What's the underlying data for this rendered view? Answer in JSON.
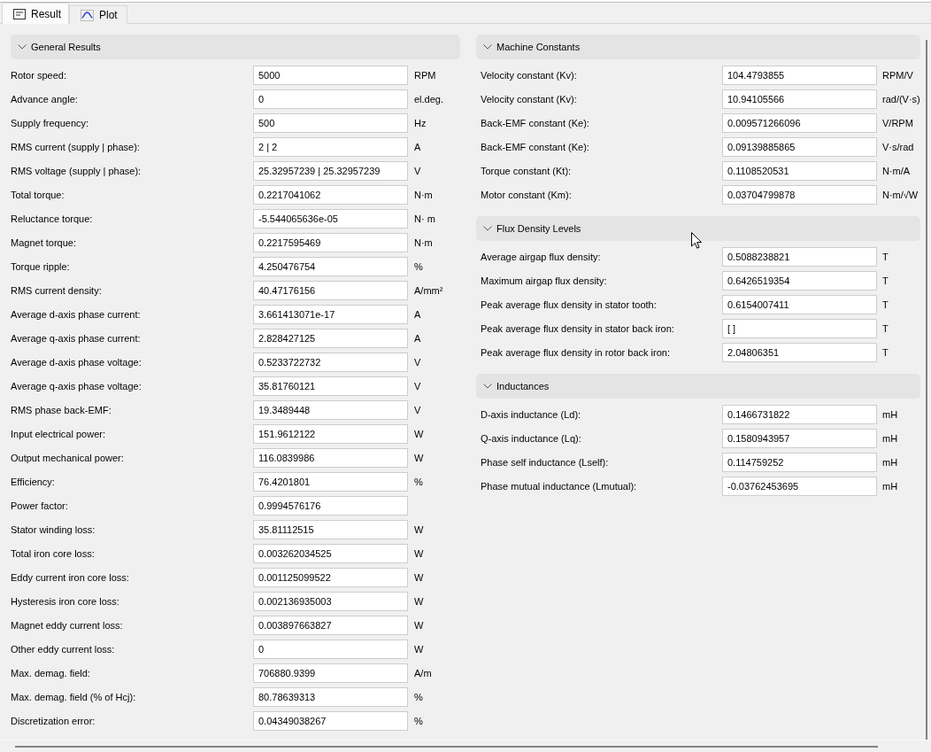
{
  "tabs": [
    {
      "label": "Result",
      "kind": "text",
      "selected": true
    },
    {
      "label": "Plot",
      "kind": "plot",
      "selected": false
    }
  ],
  "left_column": {
    "sections": [
      {
        "title": "General Results",
        "expanded": true,
        "rows": [
          {
            "label": "Rotor speed:",
            "value": "5000",
            "unit": "RPM"
          },
          {
            "label": "Advance angle:",
            "value": "0",
            "unit": "el.deg."
          },
          {
            "label": "Supply frequency:",
            "value": "500",
            "unit": "Hz"
          },
          {
            "label": "RMS current (supply | phase):",
            "value": "2 | 2",
            "unit": "A"
          },
          {
            "label": "RMS voltage (supply | phase):",
            "value": "25.32957239 | 25.32957239",
            "unit": "V"
          },
          {
            "label": "Total torque:",
            "value": "0.2217041062",
            "unit": "N·m"
          },
          {
            "label": "Reluctance torque:",
            "value": "-5.544065636e-05",
            "unit": "N· m"
          },
          {
            "label": "Magnet torque:",
            "value": "0.2217595469",
            "unit": "N·m"
          },
          {
            "label": "Torque ripple:",
            "value": "4.250476754",
            "unit": "%"
          },
          {
            "label": "RMS current density:",
            "value": "40.47176156",
            "unit": "A/mm²"
          },
          {
            "label": "Average d-axis phase current:",
            "value": "3.661413071e-17",
            "unit": "A"
          },
          {
            "label": "Average q-axis phase current:",
            "value": "2.828427125",
            "unit": "A"
          },
          {
            "label": "Average d-axis phase voltage:",
            "value": "0.5233722732",
            "unit": "V"
          },
          {
            "label": "Average q-axis phase voltage:",
            "value": "35.81760121",
            "unit": "V"
          },
          {
            "label": "RMS phase back-EMF:",
            "value": "19.3489448",
            "unit": "V"
          },
          {
            "label": "Input electrical power:",
            "value": "151.9612122",
            "unit": "W"
          },
          {
            "label": "Output mechanical power:",
            "value": "116.0839986",
            "unit": "W"
          },
          {
            "label": "Efficiency:",
            "value": "76.4201801",
            "unit": "%"
          },
          {
            "label": "Power factor:",
            "value": "0.9994576176"
          },
          {
            "label": "Stator winding loss:",
            "value": "35.81112515",
            "unit": "W"
          },
          {
            "label": "Total iron core loss:",
            "value": "0.003262034525",
            "unit": "W"
          },
          {
            "label": "Eddy current iron core loss:",
            "value": "0.001125099522",
            "unit": "W"
          },
          {
            "label": "Hysteresis iron core loss:",
            "value": "0.002136935003",
            "unit": "W"
          },
          {
            "label": "Magnet eddy current loss:",
            "value": "0.003897663827",
            "unit": "W"
          },
          {
            "label": "Other eddy current loss:",
            "value": "0",
            "unit": "W"
          },
          {
            "label": "Max. demag. field:",
            "value": "706880.9399",
            "unit": "A/m"
          },
          {
            "label": "Max. demag. field (% of Hcj):",
            "value": "80.78639313",
            "unit": "%"
          },
          {
            "label": "Discretization error:",
            "value": "0.04349038267",
            "unit": "%"
          }
        ]
      }
    ]
  },
  "right_column": {
    "sections": [
      {
        "title": "Machine Constants",
        "expanded": true,
        "rows": [
          {
            "label": "Velocity constant (Kv):",
            "value": "104.4793855",
            "unit": "RPM/V"
          },
          {
            "label": "Velocity constant (Kv):",
            "value": "10.94105566",
            "unit": "rad/(V·s)"
          },
          {
            "label": "Back-EMF constant (Ke):",
            "value": "0.009571266096",
            "unit": "V/RPM"
          },
          {
            "label": "Back-EMF constant (Ke):",
            "value": "0.09139885865",
            "unit": "V·s/rad"
          },
          {
            "label": "Torque constant (Kt):",
            "value": "0.1108520531",
            "unit": "N·m/A"
          },
          {
            "label": "Motor constant (Km):",
            "value": "0.03704799878",
            "unit": "N·m/√W"
          }
        ]
      },
      {
        "title": "Flux Density Levels",
        "expanded": true,
        "rows": [
          {
            "label": "Average airgap flux density:",
            "value": "0.5088238821",
            "unit": "T"
          },
          {
            "label": "Maximum airgap flux density:",
            "value": "0.6426519354",
            "unit": "T"
          },
          {
            "label": "Peak average flux density in stator tooth:",
            "value": "0.6154007411",
            "unit": "T"
          },
          {
            "label": "Peak average flux density in stator back iron:",
            "value": "[ ]",
            "unit": "T"
          },
          {
            "label": "Peak average flux density in rotor back iron:",
            "value": "2.04806351",
            "unit": "T"
          }
        ]
      },
      {
        "title": "Inductances",
        "expanded": true,
        "rows": [
          {
            "label": "D-axis inductance (Ld):",
            "value": "0.1466731822",
            "unit": "mH"
          },
          {
            "label": "Q-axis inductance (Lq):",
            "value": "0.1580943957",
            "unit": "mH"
          },
          {
            "label": "Phase self inductance (Lself):",
            "value": "0.114759252",
            "unit": "mH"
          },
          {
            "label": "Phase mutual inductance (Lmutual):",
            "value": "-0.03762453695",
            "unit": "mH"
          }
        ]
      }
    ]
  }
}
